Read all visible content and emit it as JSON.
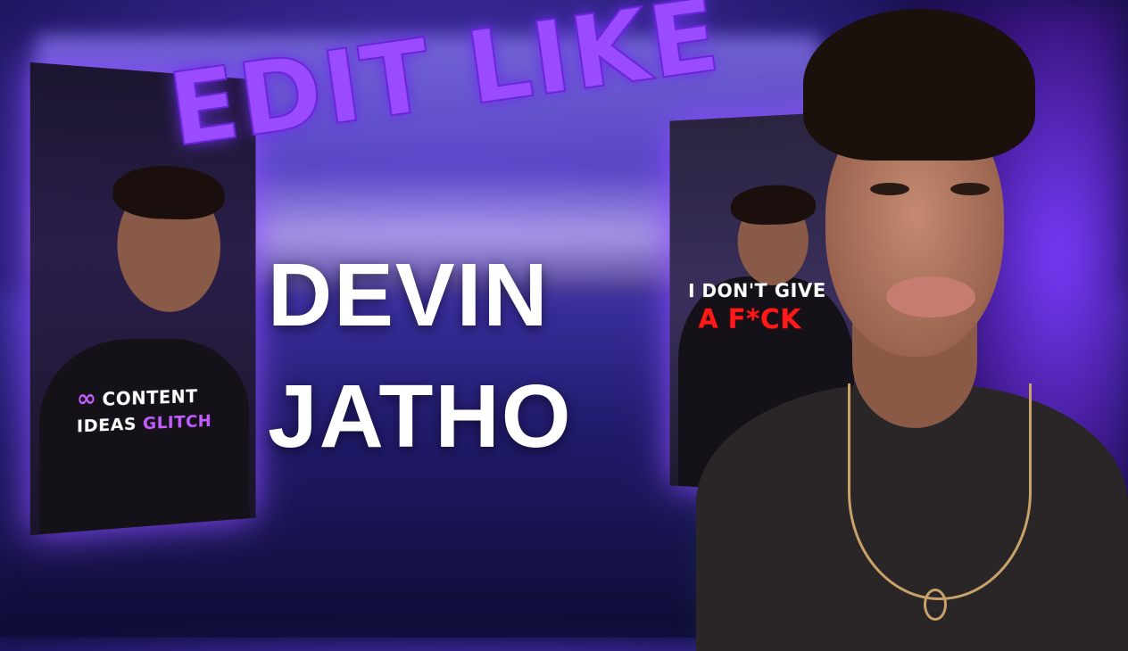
{
  "headline": {
    "line1": "EDIT LIKE",
    "line2": "DEVIN",
    "line3": "JATHO"
  },
  "left_clip": {
    "caption_icon": "infinity-icon",
    "caption_icon_glyph": "∞",
    "caption_line1": "CONTENT",
    "caption_line2_a": "IDEAS",
    "caption_line2_b": "GLITCH"
  },
  "right_clip": {
    "caption_line1": "I DON'T GIVE",
    "caption_line2": "A F*CK"
  },
  "colors": {
    "accent_purple": "#9b4bff",
    "caption_red": "#ff1a1a"
  }
}
